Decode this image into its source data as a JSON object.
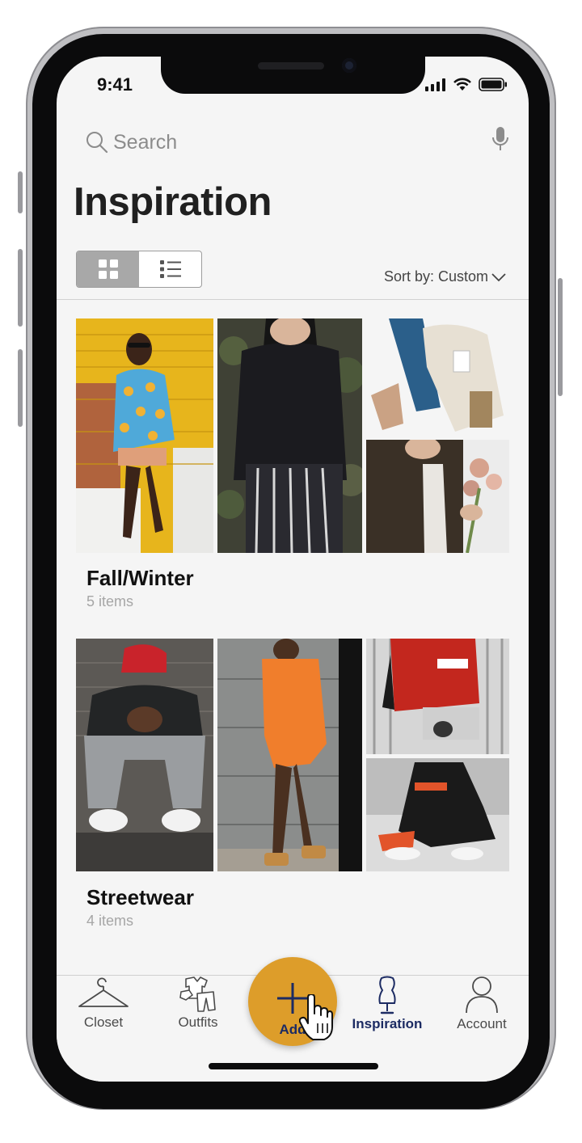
{
  "status": {
    "time": "9:41"
  },
  "search": {
    "placeholder": "Search"
  },
  "page": {
    "title": "Inspiration"
  },
  "toolbar": {
    "sort_label": "Sort by: Custom"
  },
  "collections": [
    {
      "title": "Fall/Winter",
      "count": "5 items"
    },
    {
      "title": "Streetwear",
      "count": "4 items"
    }
  ],
  "tabs": [
    {
      "label": "Closet",
      "icon": "hanger-icon"
    },
    {
      "label": "Outfits",
      "icon": "outfits-icon"
    },
    {
      "label": "Add",
      "icon": "plus-icon"
    },
    {
      "label": "Inspiration",
      "icon": "dress-form-icon"
    },
    {
      "label": "Account",
      "icon": "person-icon"
    }
  ],
  "colors": {
    "accent": "#dd9d2a",
    "active_tab": "#1c2b63"
  }
}
